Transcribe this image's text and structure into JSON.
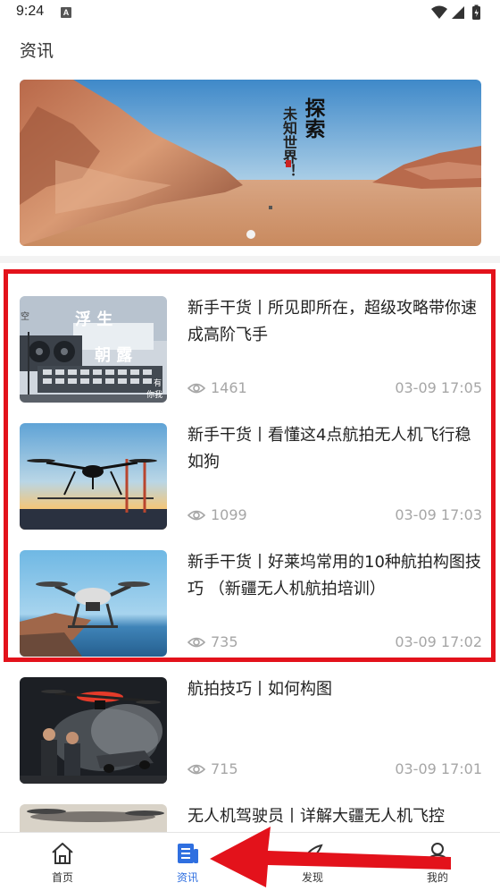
{
  "status": {
    "time": "9:24",
    "notif_letter": "A"
  },
  "page": {
    "title": "资讯"
  },
  "banner": {
    "line1": "探索",
    "line2": "未知世界！"
  },
  "articles": [
    {
      "title": "新手干货丨所见即所在，超级攻略带你速成高阶飞手",
      "views": "1461",
      "date": "03-09 17:05",
      "thumb_text_1": "浮 生",
      "thumb_text_2": "朝 露",
      "thumb_edge_left": "空",
      "thumb_edge_right_1": "有",
      "thumb_edge_right_2": "你我"
    },
    {
      "title": "新手干货丨看懂这4点航拍无人机飞行稳如狗",
      "views": "1099",
      "date": "03-09 17:03"
    },
    {
      "title": "新手干货丨好莱坞常用的10种航拍构图技巧 （新疆无人机航拍培训）",
      "views": "735",
      "date": "03-09 17:02"
    },
    {
      "title": "航拍技巧丨如何构图",
      "views": "715",
      "date": "03-09 17:01"
    },
    {
      "title": "无人机驾驶员丨详解大疆无人机飞控"
    }
  ],
  "tabs": [
    {
      "label": "首页",
      "icon": "home-icon"
    },
    {
      "label": "资讯",
      "icon": "news-icon",
      "active": true
    },
    {
      "label": "发现",
      "icon": "discover-icon"
    },
    {
      "label": "我的",
      "icon": "profile-icon"
    }
  ],
  "colors": {
    "accent": "#2f6fe0",
    "highlight": "#e3121b",
    "meta": "#a6a6a6"
  }
}
